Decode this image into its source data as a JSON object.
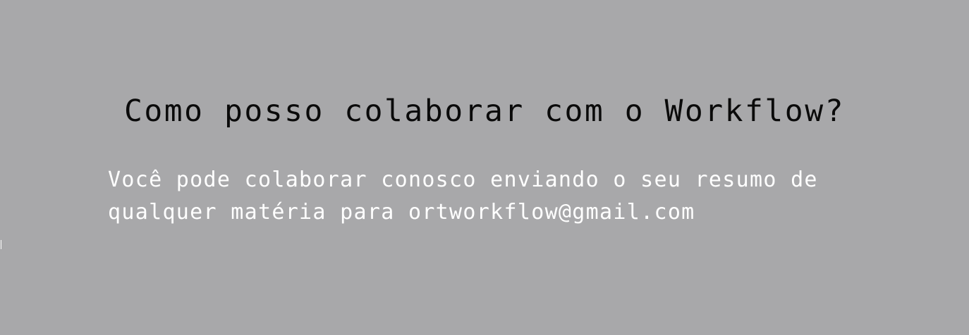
{
  "faq": {
    "question": "Como posso colaborar com o Workflow?",
    "answer_line_1": "Você pode colaborar conosco enviando o seu resumo de",
    "answer_line_2": "qualquer matéria para ortworkflow@gmail.com"
  }
}
